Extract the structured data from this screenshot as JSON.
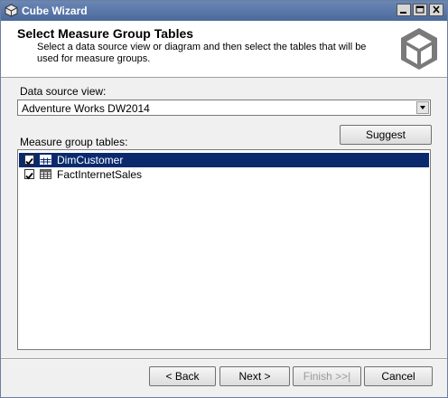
{
  "window": {
    "title": "Cube Wizard"
  },
  "header": {
    "title": "Select Measure Group Tables",
    "description": "Select a data source view or diagram and then select the tables that will be used for measure groups."
  },
  "data_source_view": {
    "label": "Data source view:",
    "value": "Adventure Works DW2014"
  },
  "measure_group_tables": {
    "label": "Measure group tables:",
    "suggest_label": "Suggest",
    "items": [
      {
        "label": "DimCustomer",
        "checked": true,
        "selected": true
      },
      {
        "label": "FactInternetSales",
        "checked": true,
        "selected": false
      }
    ]
  },
  "footer": {
    "back_label": "< Back",
    "next_label": "Next >",
    "finish_label": "Finish >>|",
    "cancel_label": "Cancel"
  }
}
